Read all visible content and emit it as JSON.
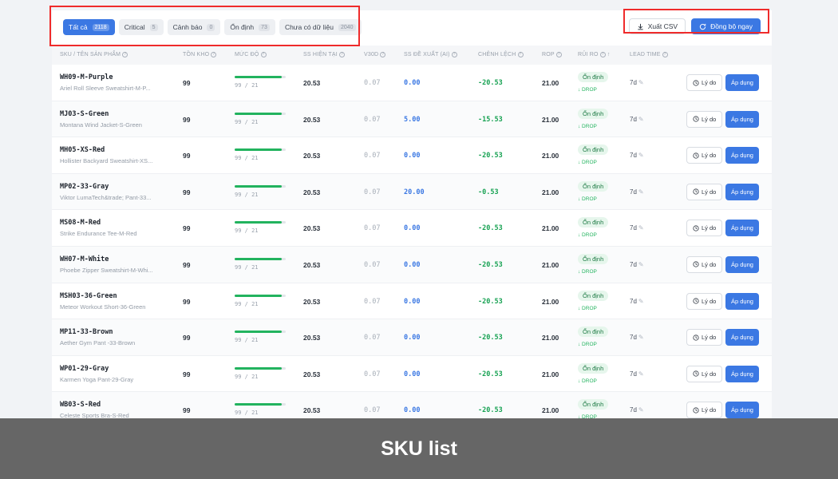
{
  "filters": [
    {
      "label": "Tất cả",
      "count": "2118",
      "active": true
    },
    {
      "label": "Critical",
      "count": "5",
      "active": false
    },
    {
      "label": "Cảnh báo",
      "count": "0",
      "active": false
    },
    {
      "label": "Ổn định",
      "count": "73",
      "active": false
    },
    {
      "label": "Chưa có dữ liệu",
      "count": "2040",
      "active": false
    }
  ],
  "actions": {
    "export_label": "Xuất CSV",
    "sync_label": "Đồng bộ ngay"
  },
  "columns": {
    "sku": "SKU / TÊN SẢN PHẨM",
    "tonkho": "TỒN KHO",
    "mucdo": "MỨC ĐỘ",
    "ss": "SS HIỆN TẠI",
    "v30d": "V30D",
    "ssai": "SS ĐỀ XUẤT (AI)",
    "diff": "CHÊNH LỆCH",
    "rop": "ROP",
    "rui_ro": "RỦI RO",
    "rui_ro_sort": "↑",
    "lead": "LEAD TIME"
  },
  "row_labels": {
    "reason": "Lý do",
    "apply": "Áp dụng",
    "drop": "↓ DROP"
  },
  "colors": {
    "primary": "#3b78e3",
    "success": "#22b35e",
    "highlight": "#ef2b2b"
  },
  "rows": [
    {
      "sku": "WH09-M-Purple",
      "name": "Ariel Roll Sleeve Sweatshirt-M-P...",
      "tonkho": "99",
      "level": 0.92,
      "level_label": "99 / 21",
      "ss": "20.53",
      "v30d": "0.07",
      "ss_ai": "0.00",
      "diff": "-20.53",
      "rop": "21.00",
      "risk": "Ổn định",
      "lead": "7d"
    },
    {
      "sku": "MJ03-S-Green",
      "name": "Montana Wind Jacket-S-Green",
      "tonkho": "99",
      "level": 0.92,
      "level_label": "99 / 21",
      "ss": "20.53",
      "v30d": "0.07",
      "ss_ai": "5.00",
      "diff": "-15.53",
      "rop": "21.00",
      "risk": "Ổn định",
      "lead": "7d"
    },
    {
      "sku": "MH05-XS-Red",
      "name": "Hollister Backyard Sweatshirt-XS...",
      "tonkho": "99",
      "level": 0.92,
      "level_label": "99 / 21",
      "ss": "20.53",
      "v30d": "0.07",
      "ss_ai": "0.00",
      "diff": "-20.53",
      "rop": "21.00",
      "risk": "Ổn định",
      "lead": "7d"
    },
    {
      "sku": "MP02-33-Gray",
      "name": "Viktor LumaTech&trade; Pant-33...",
      "tonkho": "99",
      "level": 0.92,
      "level_label": "99 / 21",
      "ss": "20.53",
      "v30d": "0.07",
      "ss_ai": "20.00",
      "diff": "-0.53",
      "rop": "21.00",
      "risk": "Ổn định",
      "lead": "7d"
    },
    {
      "sku": "MS08-M-Red",
      "name": "Strike Endurance Tee-M-Red",
      "tonkho": "99",
      "level": 0.92,
      "level_label": "99 / 21",
      "ss": "20.53",
      "v30d": "0.07",
      "ss_ai": "0.00",
      "diff": "-20.53",
      "rop": "21.00",
      "risk": "Ổn định",
      "lead": "7d"
    },
    {
      "sku": "WH07-M-White",
      "name": "Phoebe Zipper Sweatshirt-M-Whi...",
      "tonkho": "99",
      "level": 0.92,
      "level_label": "99 / 21",
      "ss": "20.53",
      "v30d": "0.07",
      "ss_ai": "0.00",
      "diff": "-20.53",
      "rop": "21.00",
      "risk": "Ổn định",
      "lead": "7d"
    },
    {
      "sku": "MSH03-36-Green",
      "name": "Meteor Workout Short-36-Green",
      "tonkho": "99",
      "level": 0.92,
      "level_label": "99 / 21",
      "ss": "20.53",
      "v30d": "0.07",
      "ss_ai": "0.00",
      "diff": "-20.53",
      "rop": "21.00",
      "risk": "Ổn định",
      "lead": "7d"
    },
    {
      "sku": "MP11-33-Brown",
      "name": "Aether Gym Pant -33-Brown",
      "tonkho": "99",
      "level": 0.92,
      "level_label": "99 / 21",
      "ss": "20.53",
      "v30d": "0.07",
      "ss_ai": "0.00",
      "diff": "-20.53",
      "rop": "21.00",
      "risk": "Ổn định",
      "lead": "7d"
    },
    {
      "sku": "WP01-29-Gray",
      "name": "Karmen Yoga Pant-29-Gray",
      "tonkho": "99",
      "level": 0.92,
      "level_label": "99 / 21",
      "ss": "20.53",
      "v30d": "0.07",
      "ss_ai": "0.00",
      "diff": "-20.53",
      "rop": "21.00",
      "risk": "Ổn định",
      "lead": "7d"
    },
    {
      "sku": "WB03-S-Red",
      "name": "Celeste Sports Bra-S-Red",
      "tonkho": "99",
      "level": 0.92,
      "level_label": "99 / 21",
      "ss": "20.53",
      "v30d": "0.07",
      "ss_ai": "0.00",
      "diff": "-20.53",
      "rop": "21.00",
      "risk": "Ổn định",
      "lead": "7d"
    }
  ],
  "caption": "SKU list"
}
